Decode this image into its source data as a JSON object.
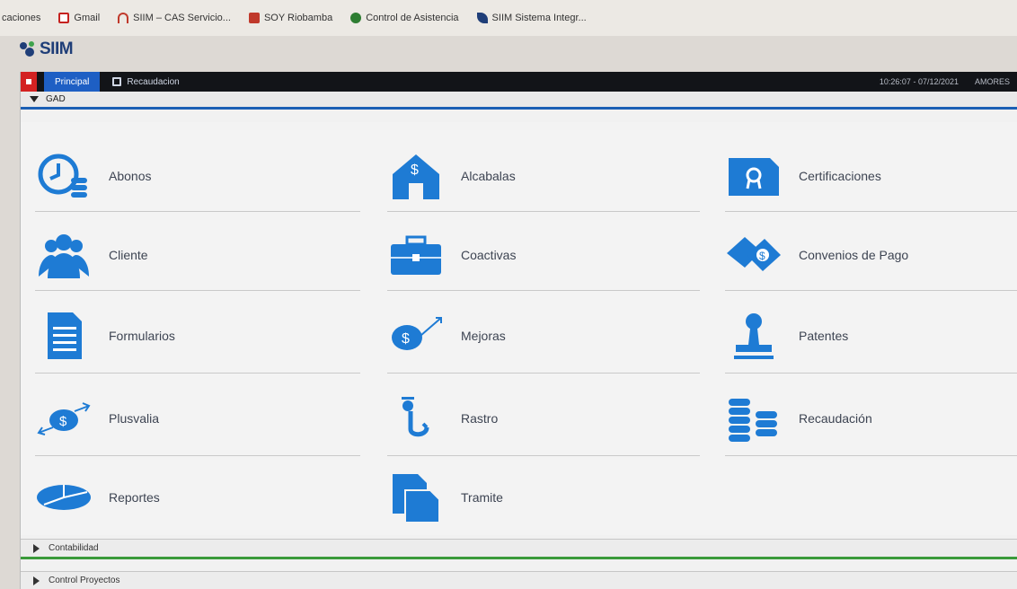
{
  "bookmarks": [
    {
      "label": "caciones",
      "icon": "text-only",
      "color": "#ece9e4"
    },
    {
      "label": "Gmail",
      "icon": "gmail-icon",
      "color": "#c5221f"
    },
    {
      "label": "SIIM – CAS Servicio...",
      "icon": "arch-icon",
      "color": "#c0392b"
    },
    {
      "label": "SOY Riobamba",
      "icon": "red-square-icon",
      "color": "#c0392b"
    },
    {
      "label": "Control de Asistencia",
      "icon": "green-badge-icon",
      "color": "#2e7d32"
    },
    {
      "label": "SIIM Sistema Integr...",
      "icon": "bird-icon",
      "color": "#1f3e78"
    }
  ],
  "logo": {
    "text": "SIIM"
  },
  "topbar": {
    "tab_active": "Principal",
    "tab_other": "Recaudacion",
    "datetime": "10:26:07 - 07/12/2021",
    "user": "AMORES"
  },
  "section": {
    "title": "GAD"
  },
  "modules": [
    {
      "label": "Abonos",
      "icon": "clock-coins-icon"
    },
    {
      "label": "Alcabalas",
      "icon": "house-dollar-icon"
    },
    {
      "label": "Certificaciones",
      "icon": "certificate-icon"
    },
    {
      "label": "Cliente",
      "icon": "users-group-icon"
    },
    {
      "label": "Coactivas",
      "icon": "briefcase-icon"
    },
    {
      "label": "Convenios de Pago",
      "icon": "handshake-icon"
    },
    {
      "label": "Formularios",
      "icon": "document-icon"
    },
    {
      "label": "Mejoras",
      "icon": "money-growth-icon"
    },
    {
      "label": "Patentes",
      "icon": "stamp-icon"
    },
    {
      "label": "Plusvalia",
      "icon": "money-exchange-icon"
    },
    {
      "label": "Rastro",
      "icon": "hook-icon"
    },
    {
      "label": "Recaudación",
      "icon": "coin-stacks-icon"
    },
    {
      "label": "Reportes",
      "icon": "pie-chart-icon"
    },
    {
      "label": "Tramite",
      "icon": "files-icon"
    }
  ],
  "footer_sections": [
    {
      "label": "Contabilidad"
    },
    {
      "label": "Control Proyectos"
    }
  ],
  "colors": {
    "accent": "#1e7bd4",
    "topbar": "#121418",
    "tab_active": "#1e5fc4"
  }
}
